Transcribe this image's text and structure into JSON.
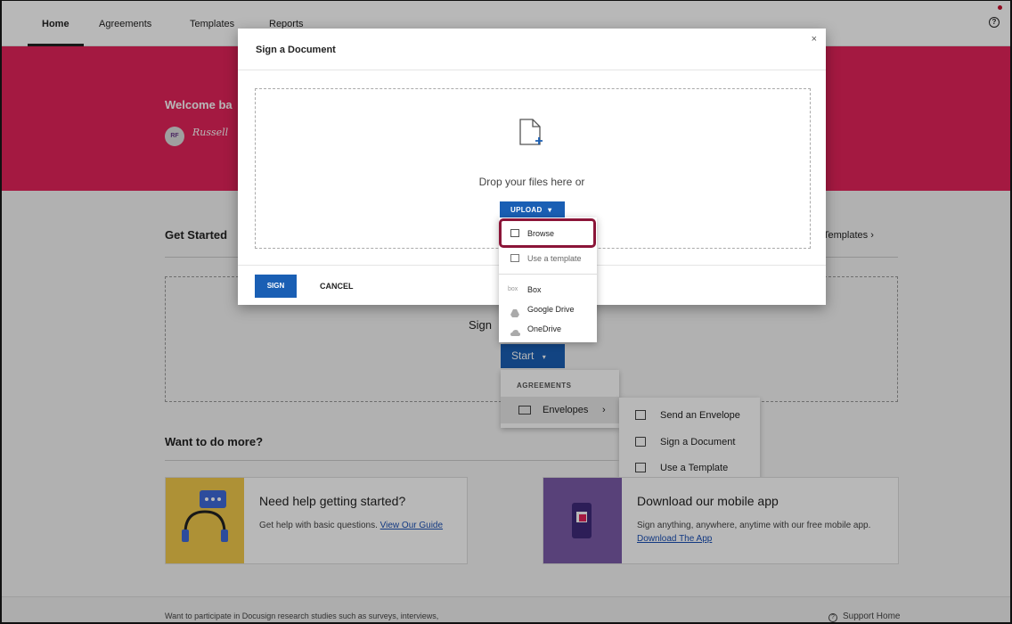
{
  "nav": {
    "tabs": [
      "Home",
      "Agreements",
      "Templates",
      "Reports"
    ]
  },
  "hero": {
    "welcome": "Welcome ba",
    "avatar_initials": "RF",
    "signature": "Russell"
  },
  "get_started": {
    "title": "Get Started",
    "templates_link": "Templates",
    "sign_text": "Sign",
    "start_label": "Start"
  },
  "start_menu": {
    "header": "AGREEMENTS",
    "envelopes": "Envelopes"
  },
  "submenu": {
    "items": [
      "Send an Envelope",
      "Sign a Document",
      "Use a Template"
    ]
  },
  "want_more": {
    "title": "Want to do more?"
  },
  "card_help": {
    "title": "Need help getting started?",
    "text": "Get help with basic questions.",
    "link": "View Our Guide"
  },
  "card_mobile": {
    "title": "Download our mobile app",
    "text": "Sign anything, anywhere, anytime with our free mobile app.",
    "link": "Download The App"
  },
  "footer": {
    "research_text": "Want to participate in Docusign research studies such as surveys, interviews,",
    "support": "Support Home"
  },
  "modal": {
    "title": "Sign a Document",
    "close": "×",
    "drop_text": "Drop your files here or",
    "upload_label": "UPLOAD",
    "sign_label": "SIGN",
    "cancel_label": "CANCEL"
  },
  "upload_menu": {
    "browse": "Browse",
    "use_template": "Use a template",
    "box": "Box",
    "box_logo": "box",
    "google_drive": "Google Drive",
    "onedrive": "OneDrive"
  },
  "colors": {
    "hero": "#e3235a",
    "primary": "#1a5fb4",
    "highlight": "#8b1538"
  }
}
